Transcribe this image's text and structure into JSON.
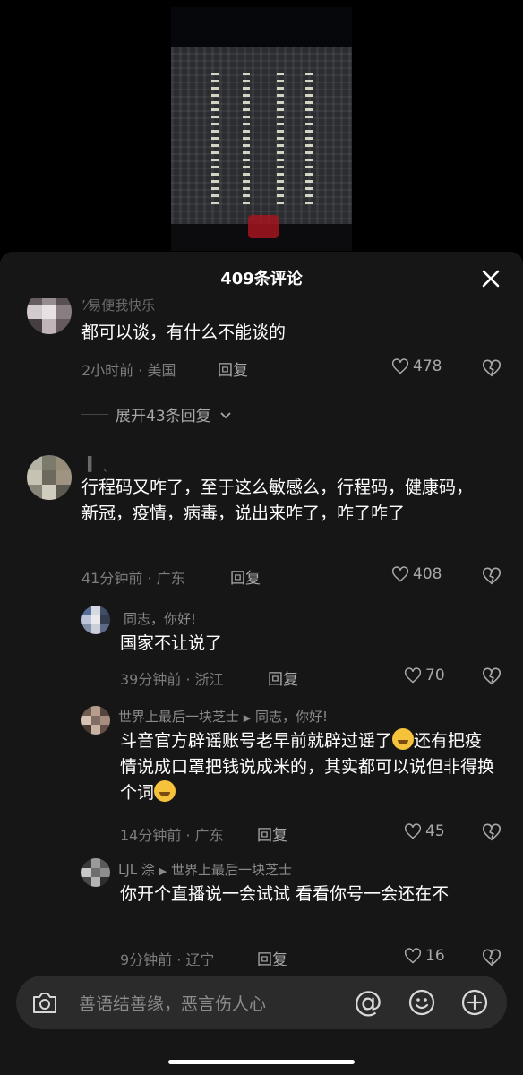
{
  "sheet": {
    "title": "409条评论"
  },
  "comments": [
    {
      "name": "ʼ⁄易便我快乐",
      "text": "都可以谈，有什么不能谈的",
      "meta": "2小时前 · 美国",
      "reply": "回复",
      "likes": "478",
      "expand": "展开43条回复"
    },
    {
      "name": "▍ ˎ",
      "text": "行程码又咋了，至于这么敏感么，行程码，健康码，新冠，疫情，病毒，说出来咋了，咋了咋了",
      "meta": "41分钟前 · 广东",
      "reply": "回复",
      "likes": "408"
    }
  ],
  "replies": [
    {
      "name": "同志，你好!",
      "text": "国家不让说了",
      "meta": "39分钟前 · 浙江",
      "reply": "回复",
      "likes": "70"
    },
    {
      "name": "世界上最后一块芝士",
      "reply_to": "同志，你好!",
      "text_a": "斗音官方辟谣账号老早前就辟过谣了",
      "text_b": "还有把疫情说成口罩把钱说成米的，其实都可以说但非得换个词",
      "meta": "14分钟前 · 广东",
      "reply": "回复",
      "likes": "45"
    },
    {
      "name": "LJL 涂",
      "reply_to": "世界上最后一块芝士",
      "text": "你开个直播说一会试试 看看你号一会还在不",
      "meta": "9分钟前 · 辽宁",
      "reply": "回复",
      "likes": "16"
    }
  ],
  "input": {
    "placeholder": "善语结善缘，恶言伤人心"
  },
  "icons": {
    "close": "close-icon",
    "heart": "heart-icon",
    "dislike": "broken-heart-icon",
    "camera": "camera-icon",
    "at": "at-icon",
    "emoji": "emoji-icon",
    "plus": "plus-icon"
  }
}
